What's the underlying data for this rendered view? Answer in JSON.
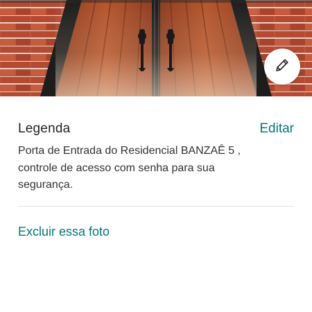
{
  "photo": {
    "alt": "Porta de Entrada do Residencial BANZAÊ 5"
  },
  "edit_photo_button": {
    "icon": "pencil-icon"
  },
  "caption": {
    "title": "Legenda",
    "edit_label": "Editar",
    "text": "Porta de Entrada do Residencial BANZAÊ 5 , controle de acesso com senha para sua segurança."
  },
  "actions": {
    "delete_label": "Excluir essa foto"
  },
  "colors": {
    "accent": "#00787a",
    "title_text": "#222222",
    "body_text": "#333333",
    "divider": "#e2e2e2"
  }
}
